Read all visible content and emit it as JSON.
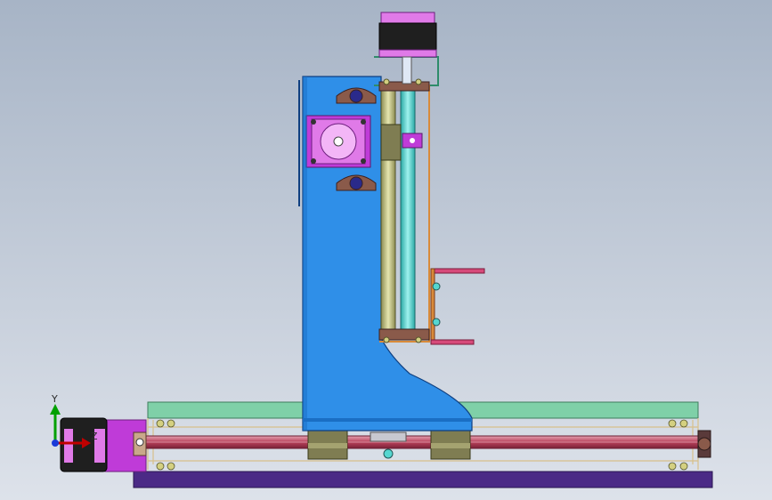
{
  "triad": {
    "y_label": "Y",
    "z_label": "Z"
  },
  "colors": {
    "bg_top": "#a7b4c6",
    "bg_bottom": "#dde2ea",
    "column_blue": "#2f8fe8",
    "base_plate": "#4b2a86",
    "rail_green": "#7fd0a8",
    "rod_red": "#b8405a",
    "motor_pink": "#e07ae8",
    "motor_magenta": "#bf3bd8",
    "motor_dark": "#1f1f1f",
    "shaft_cyan": "#56d6d0",
    "guide_yellow": "#b9b97a",
    "bearing_brown": "#8a5a4a",
    "block_olive": "#7f7d52",
    "frame_orange": "#d88a3a"
  }
}
